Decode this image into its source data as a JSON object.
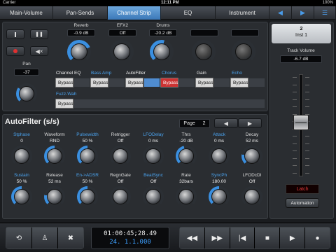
{
  "status": {
    "carrier": "Carrier",
    "time": "12:11 PM",
    "battery": "100%"
  },
  "tabs": [
    {
      "label": "Main-Volume"
    },
    {
      "label": "Pan-Sends"
    },
    {
      "label": "Channel Strip"
    },
    {
      "label": "EQ"
    },
    {
      "label": "Instrument"
    },
    {
      "label": "◀"
    },
    {
      "label": "▶"
    },
    {
      "label": "☰"
    }
  ],
  "sends": [
    {
      "label": "Reverb",
      "value": "-0.9 dB",
      "level": 0.75
    },
    {
      "label": "EFX2",
      "value": "Off",
      "level": 0.0
    },
    {
      "label": "Drums",
      "value": "-20.2 dB",
      "level": 0.55
    },
    {
      "label": "",
      "value": "",
      "level": 0
    },
    {
      "label": "",
      "value": "",
      "level": 0
    }
  ],
  "pan": {
    "label": "Pan",
    "value": "-37",
    "level": 0.3
  },
  "strip": {
    "labels": [
      "Channel EQ",
      "Bass Amp",
      "AutoFilter",
      "Chorus",
      "Gain",
      "Echo"
    ],
    "bypass": "Bypass",
    "fuzz": "Fuzz-Wah"
  },
  "plugin": {
    "title": "AutoFilter (s/s)",
    "page_label": "Page",
    "page_value": "2",
    "row1": [
      {
        "label": "Stphase",
        "value": "0",
        "level": 0.0,
        "blue": true
      },
      {
        "label": "Waveform",
        "value": "RND",
        "level": 0.5,
        "blue": false
      },
      {
        "label": "Pulsewidth",
        "value": "50 %",
        "level": 0.5,
        "blue": true
      },
      {
        "label": "Retrigger",
        "value": "Off",
        "level": 0.0,
        "blue": false
      },
      {
        "label": "LFODelay",
        "value": "0 ms",
        "level": 0.0,
        "blue": true
      },
      {
        "label": "Thrs",
        "value": "-20 dB",
        "level": 0.45,
        "blue": false
      },
      {
        "label": "Attack",
        "value": "0 ms",
        "level": 0.0,
        "blue": true
      },
      {
        "label": "Decay",
        "value": "52 ms",
        "level": 0.2,
        "blue": false
      }
    ],
    "row2": [
      {
        "label": "Sustain",
        "value": "50 %",
        "level": 0.5,
        "blue": true
      },
      {
        "label": "Release",
        "value": "52 ms",
        "level": 0.2,
        "blue": false
      },
      {
        "label": "En->ADSR",
        "value": "50 %",
        "level": 0.5,
        "blue": true
      },
      {
        "label": "RegnGate",
        "value": "Off",
        "level": 0.0,
        "blue": false
      },
      {
        "label": "BeatSync",
        "value": "Off",
        "level": 0.0,
        "blue": true
      },
      {
        "label": "Rate",
        "value": "32bars",
        "level": 0.0,
        "blue": false
      },
      {
        "label": "SyncPh",
        "value": "180.00",
        "level": 0.5,
        "blue": true
      },
      {
        "label": "LFODcDI",
        "value": "Off",
        "level": 0.0,
        "blue": false
      }
    ]
  },
  "inst": {
    "number": "2",
    "name": "Inst 1"
  },
  "track_volume": {
    "label": "Track Volume",
    "value": "-6.7 dB",
    "level": 0.6
  },
  "latch": "Latch",
  "automation": "Automation",
  "transport": {
    "left_buttons": [
      "⟲",
      "♙",
      "✖"
    ],
    "timecode": "01:00:45;28.49",
    "bars": "24.  1.1.000",
    "buttons": [
      "◀◀",
      "▶▶",
      "|◀",
      "■",
      "▶",
      "●"
    ]
  },
  "colors": {
    "accent": "#3a8fe0",
    "active_tab": "#4f8fd4",
    "bypass_red": "#cc3333",
    "latch_red": "#e03a3a"
  }
}
